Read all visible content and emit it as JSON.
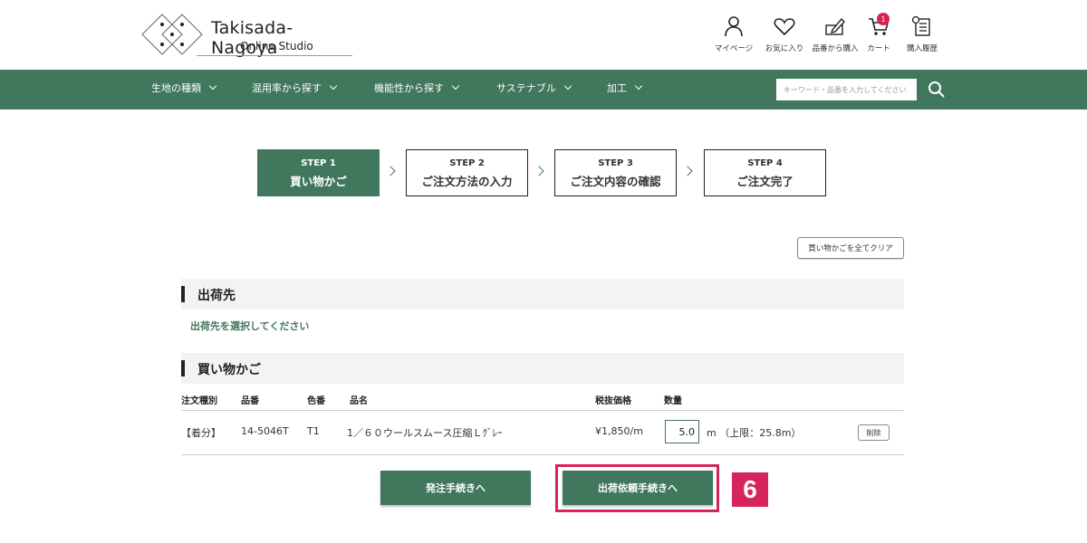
{
  "brand": {
    "title": "Takisada-Nagoya",
    "subtitle": "Online Studio"
  },
  "header_icons": [
    {
      "label": "マイページ",
      "icon": "user-icon"
    },
    {
      "label": "お気に入り",
      "icon": "heart-icon"
    },
    {
      "label": "品番から購入",
      "icon": "pencil-icon"
    },
    {
      "label": "カート",
      "icon": "cart-icon",
      "badge": "1"
    },
    {
      "label": "購入履歴",
      "icon": "history-icon"
    }
  ],
  "nav": {
    "items": [
      "生地の種類",
      "混用率から探す",
      "機能性から探す",
      "サステナブル",
      "加工"
    ],
    "search_placeholder": "キーワード・品番を入力してください"
  },
  "steps": [
    {
      "num": "STEP 1",
      "name": "買い物かご",
      "active": true
    },
    {
      "num": "STEP 2",
      "name": "ご注文方法の入力",
      "active": false
    },
    {
      "num": "STEP 3",
      "name": "ご注文内容の確認",
      "active": false
    },
    {
      "num": "STEP 4",
      "name": "ご注文完了",
      "active": false
    }
  ],
  "clear_cart_label": "買い物かごを全てクリア",
  "shipping": {
    "title": "出荷先",
    "note": "出荷先を選択してください"
  },
  "cart": {
    "title": "買い物かご",
    "columns": [
      "注文種別",
      "品番",
      "色番",
      "品名",
      "税抜価格",
      "数量"
    ],
    "rows": [
      {
        "type": "【着分】",
        "item_no": "14-5046T",
        "color_no": "T1",
        "name": "1／６０ウールスムース圧縮Ｌｸﾞﾚｰ",
        "price": "¥1,850/m",
        "qty": "5.0",
        "unit_limit": "m （上限：25.8m）",
        "delete_label": "削除"
      }
    ]
  },
  "buttons": {
    "order": "発注手続きへ",
    "shipment": "出荷依頼手続きへ"
  },
  "callout_number": "6",
  "colors": {
    "accent": "#41775c",
    "highlight": "#d7245c",
    "badge": "#d9234d"
  }
}
